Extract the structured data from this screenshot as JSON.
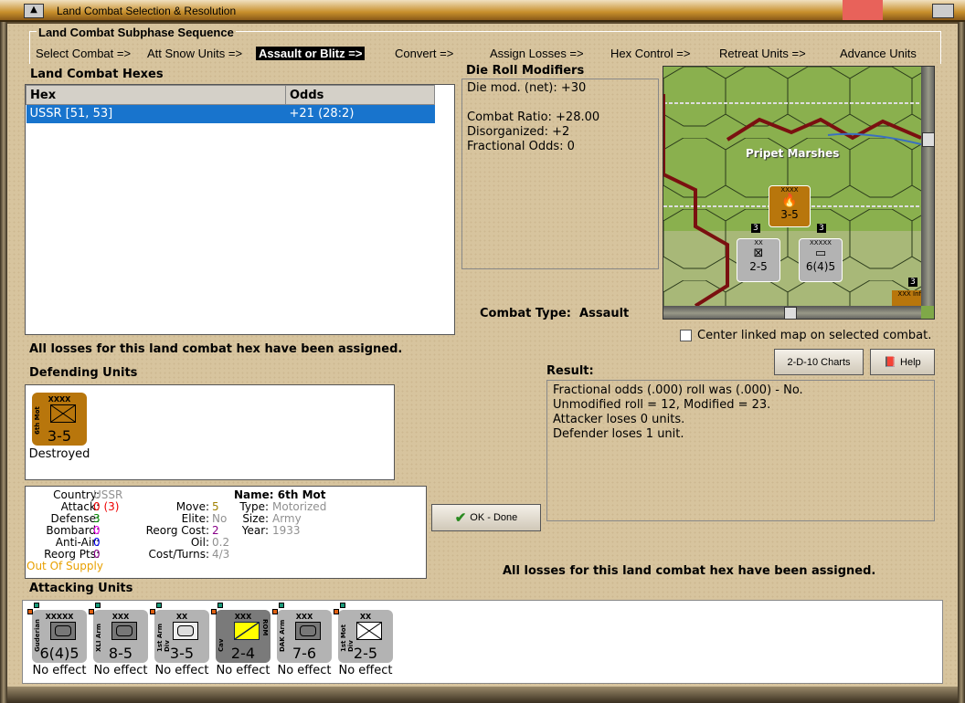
{
  "window": {
    "title": "Land Combat Selection & Resolution"
  },
  "subphase": {
    "title": "Land Combat Subphase Sequence",
    "steps": [
      "Select Combat =>",
      "Att Snow Units =>",
      "Assault or Blitz =>",
      "Convert =>",
      "Assign Losses =>",
      "Hex Control =>",
      "Retreat Units =>",
      "Advance Units"
    ],
    "active_index": 2
  },
  "hexes": {
    "title": "Land Combat Hexes",
    "columns": [
      "Hex",
      "Odds"
    ],
    "rows": [
      {
        "hex": "USSR [51, 53]",
        "odds": "+21 (28:2)"
      }
    ]
  },
  "modifiers": {
    "title": "Die Roll Modifiers",
    "lines": [
      "Die mod. (net): +30",
      "",
      "Combat Ratio: +28.00",
      "Disorganized: +2",
      "Fractional Odds: 0"
    ]
  },
  "map": {
    "region_label": "Pripet Marshes",
    "defender": {
      "name": "6th Mot",
      "size": "XXXX",
      "strength": "3-5"
    },
    "attackers": [
      {
        "name": "1st Mot Div",
        "size": "XX",
        "strength": "2-5",
        "badge": "3"
      },
      {
        "name": "Guderian",
        "size": "XXXXX",
        "strength": "6(4)5",
        "badge": "3"
      }
    ],
    "edge_badge": "3",
    "edge_unit_size": "XXX",
    "edge_unit_name": "Inf"
  },
  "combat_type": {
    "label": "Combat Type:",
    "value": "Assault"
  },
  "center_map": {
    "label": "Center linked map on selected combat.",
    "checked": false
  },
  "losses_msg_left": "All losses for this land combat hex have been assigned.",
  "losses_msg_right": "All losses for this land combat hex have been assigned.",
  "buttons": {
    "charts": "2-D-10 Charts",
    "help": "Help",
    "ok": "OK - Done"
  },
  "defending": {
    "title": "Defending Units",
    "units": [
      {
        "name": "6th Mot",
        "size": "XXXX",
        "strength": "3-5",
        "status": "Destroyed"
      }
    ]
  },
  "result": {
    "title": "Result:",
    "lines": [
      "Fractional odds (.000) roll was (.000)  - No.",
      "Unmodified roll = 12, Modified = 23.",
      "Attacker loses 0 units.",
      "Defender loses 1 unit."
    ]
  },
  "unit_info": {
    "country": "USSR",
    "attack": "0",
    "attack_extra": "(3)",
    "defense": "3",
    "bombard": "0",
    "anti_air": "0",
    "reorg_pts": "0",
    "supply": "Out Of Supply",
    "move": "5",
    "elite": "No",
    "reorg_cost": "2",
    "oil": "0.2",
    "cost_turns": "4/3",
    "name": "Name: 6th Mot",
    "type": "Motorized",
    "size": "Army",
    "year": "1933",
    "labels": {
      "country": "Country:",
      "attack": "Attack:",
      "defense": "Defense:",
      "bombard": "Bombard:",
      "anti_air": "Anti-Air:",
      "reorg_pts": "Reorg Pts:",
      "move": "Move:",
      "elite": "Elite:",
      "reorg_cost": "Reorg Cost:",
      "oil": "Oil:",
      "cost_turns": "Cost/Turns:",
      "type": "Type:",
      "size": "Size:",
      "year": "Year:"
    }
  },
  "attacking": {
    "title": "Attacking Units",
    "units": [
      {
        "name": "Guderian",
        "size": "XXXXX",
        "strength": "6(4)5",
        "status": "No effect"
      },
      {
        "name": "XLI Arm",
        "size": "XXX",
        "strength": "8-5",
        "status": "No effect"
      },
      {
        "name": "1st Arm Div",
        "size": "XX",
        "strength": "3-5",
        "status": "No effect"
      },
      {
        "name": "Cav",
        "side": "ROM",
        "size": "XXX",
        "strength": "2-4",
        "status": "No effect"
      },
      {
        "name": "DAK Arm",
        "size": "XXX",
        "strength": "7-6",
        "status": "No effect"
      },
      {
        "name": "1st Mot Div",
        "size": "XX",
        "strength": "2-5",
        "status": "No effect"
      }
    ]
  },
  "colors": {
    "selection": "#1874cd",
    "defender_counter": "#b8760c",
    "attacker_counter": "#b3b3b3"
  }
}
